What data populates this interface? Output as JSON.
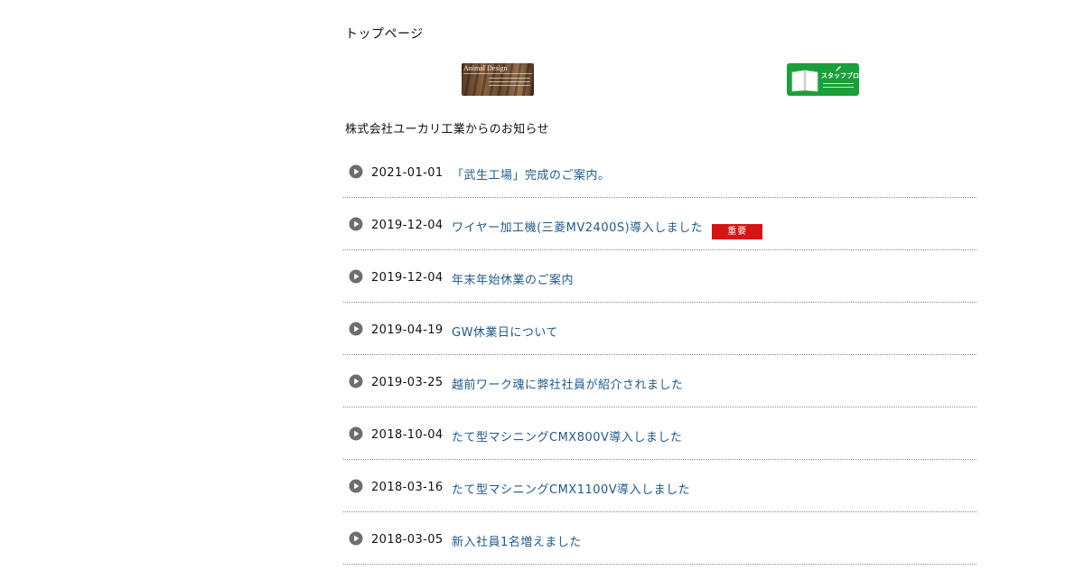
{
  "breadcrumb": {
    "current": "トップページ"
  },
  "banners": {
    "animal_design": {
      "title": "Animal Design"
    },
    "staff_blog": {
      "title": "スタッフブログ"
    }
  },
  "news": {
    "heading": "株式会社ユーカリ工業からのお知らせ",
    "items": [
      {
        "date": "2021-01-01",
        "title": "「武生工場」完成のご案内。",
        "badge": ""
      },
      {
        "date": "2019-12-04",
        "title": "ワイヤー加工機(三菱MV2400S)導入しました",
        "badge": "重要"
      },
      {
        "date": "2019-12-04",
        "title": "年末年始休業のご案内",
        "badge": ""
      },
      {
        "date": "2019-04-19",
        "title": "GW休業日について",
        "badge": ""
      },
      {
        "date": "2019-03-25",
        "title": "越前ワーク魂に弊社社員が紹介されました",
        "badge": ""
      },
      {
        "date": "2018-10-04",
        "title": "たて型マシニングCMX800V導入しました",
        "badge": ""
      },
      {
        "date": "2018-03-16",
        "title": "たて型マシニングCMX1100V導入しました",
        "badge": ""
      },
      {
        "date": "2018-03-05",
        "title": "新入社員1名増えました",
        "badge": ""
      }
    ]
  },
  "colors": {
    "link": "#1e5a8c",
    "badge": "#d81313",
    "bullet": "#6e6e6e",
    "blog_banner": "#1aa03a"
  },
  "icons": {
    "bullet": "play-circle-icon",
    "blog": "notebook-icon",
    "pen": "pen-icon"
  }
}
